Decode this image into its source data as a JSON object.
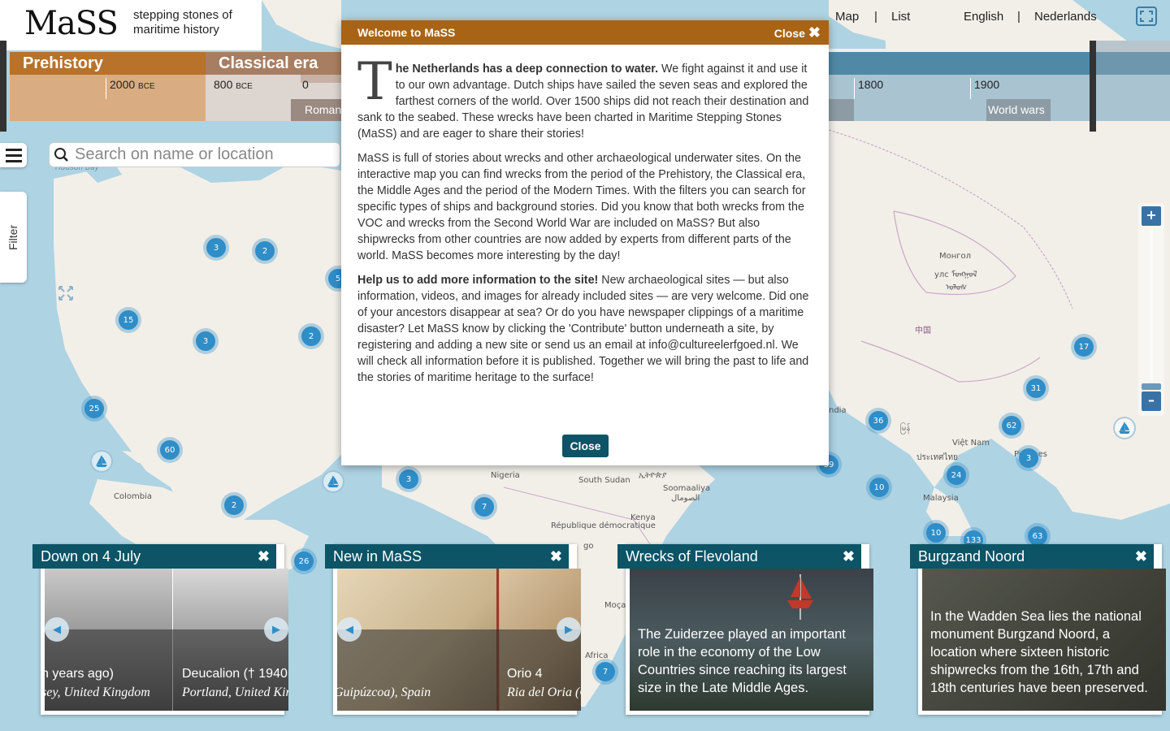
{
  "header": {
    "logo": "MaSS",
    "tagline": "stepping stones of maritime history",
    "nav": {
      "map": "Map",
      "list": "List",
      "english": "English",
      "dutch": "Nederlands",
      "separator": "|"
    }
  },
  "timeline": {
    "eras": [
      {
        "label": "Prehistory",
        "color": "#b8722a"
      },
      {
        "label": "Classical era",
        "color": "#a87e62"
      }
    ],
    "ticks": [
      {
        "label": "2000",
        "suffix": "BCE"
      },
      {
        "label": "800",
        "suffix": "BCE"
      },
      {
        "label": "0",
        "suffix": ""
      },
      {
        "label": "1800",
        "suffix": ""
      },
      {
        "label": "1900",
        "suffix": ""
      }
    ],
    "subperiods": {
      "roman": "Roman",
      "world_wars": "World wars"
    }
  },
  "search": {
    "placeholder": "Search on name or location"
  },
  "filter": {
    "label": "Filter"
  },
  "zoom": {
    "in": "+",
    "out": "–"
  },
  "map": {
    "labels": {
      "hudson_bay": "Hudson Bay",
      "colombia": "Colombia",
      "nigeria": "Nigeria",
      "south_sudan": "South Sudan",
      "somalia": "Soomaaliya",
      "somalia_ar": "الصومال",
      "ethiopia": "ኢትዮጵያ",
      "kenya": "Kenya",
      "drc": "République démocratique",
      "drc2": "go",
      "mozambique": "Moça",
      "africa": "Africa",
      "india": "ndia",
      "myanmar": "မြန်",
      "thailand": "ประเทศไทย",
      "vietnam": "Việt Nam",
      "philippines": "Pilipines",
      "malaysia": "Malaysia",
      "mongolia1": "Монгол",
      "mongolia2": "улс ᠮᠣᠩᠭᠣᠯ",
      "mongolia3": "ᠤᠯᠤᠰ",
      "china": "中国"
    },
    "clusters": [
      "3",
      "2",
      "5",
      "15",
      "3",
      "2",
      "25",
      "60",
      "2",
      "3",
      "7",
      "26",
      "17",
      "31",
      "36",
      "62",
      "3",
      "24",
      "10",
      "10",
      "133",
      "63",
      "7",
      "59"
    ]
  },
  "modal": {
    "title": "Welcome to MaSS",
    "close_top": "Close",
    "dropcap": "T",
    "p1_bold": "he Netherlands has a deep connection to water.",
    "p1_rest": " We fight against it and use it to our own advantage. Dutch ships have sailed the seven seas and explored the farthest corners of the world. Over 1500 ships did not reach their destination and sank to the seabed. These wrecks have been charted in Maritime Stepping Stones (MaSS) and are eager to share their stories!",
    "p2": "MaSS is full of stories about wrecks and other archaeological underwater sites. On the interactive map you can find wrecks from the period of the Prehistory, the Classical era, the Middle Ages and the period of the Modern Times. With the filters you can search for specific types of ships and background stories. Did you know that both wrecks from the VOC and wrecks from the Second World War are included on MaSS? But also shipwrecks from other countries are now added by experts from different parts of the world. MaSS becomes more interesting by the day!",
    "p3_bold": "Help us to add more information to the site!",
    "p3_rest": " New archaeological sites — but also information, videos, and images for already included sites — are very welcome. Did one of your ancestors disappear at sea? Or do you have newspaper clippings of a maritime disaster? Let MaSS know by clicking the 'Contribute' button underneath a site, by registering and adding a new site or send us an email at info@cultureelerfgoed.nl. We will check all information before it is published. Together we will bring the past to life and the stories of maritime heritage to the surface!",
    "close_btn": "Close"
  },
  "cards": [
    {
      "title": "Down on 4 July",
      "slides": [
        {
          "title": "n years ago)",
          "sub": "sey, United Kingdom"
        },
        {
          "title": "Deucalion († 1940",
          "sub": "Portland, United King"
        }
      ]
    },
    {
      "title": "New in MaSS",
      "slides": [
        {
          "title": "",
          "sub": "Guipúzcoa), Spain"
        },
        {
          "title": "Orio 4",
          "sub": "Ria del Oria (G"
        }
      ]
    },
    {
      "title": "Wrecks of Flevoland",
      "text": "The Zuiderzee played an important role in the economy of the Low Countries since reaching its largest size in the Late Middle Ages."
    },
    {
      "title": "Burgzand Noord",
      "text": "In the Wadden Sea lies the national monument Burgzand Noord, a location where sixteen historic shipwrecks from the 16th, 17th and 18th centuries have been preserved."
    }
  ],
  "close_icon": "✖"
}
